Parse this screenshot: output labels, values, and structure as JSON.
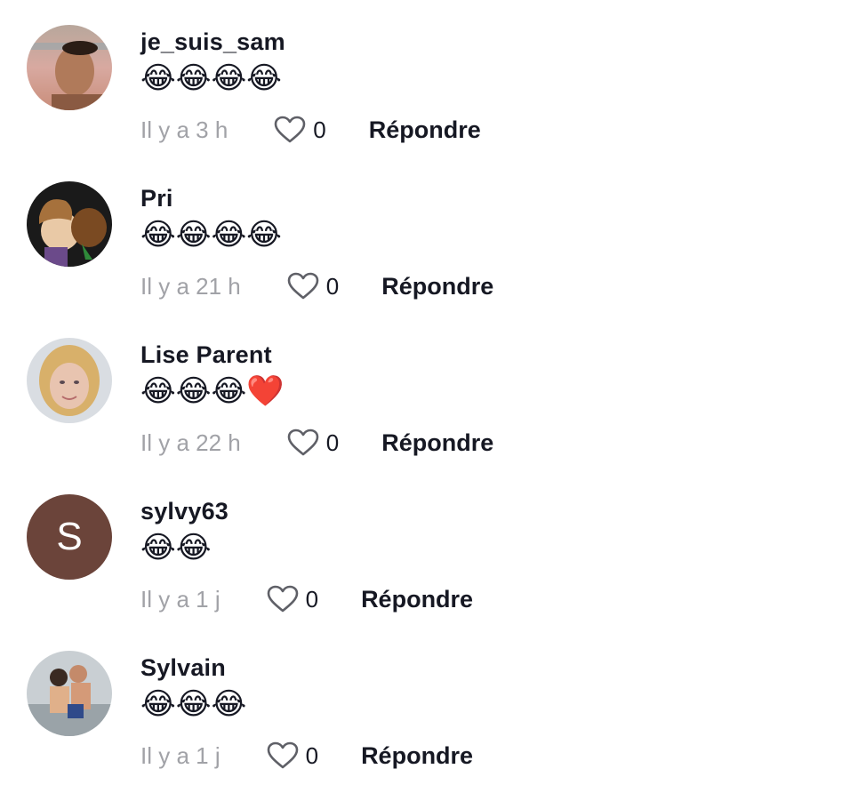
{
  "comments": [
    {
      "username": "je_suis_sam",
      "text": "😂😂😂😂",
      "time": "Il y a 3 h",
      "likes": "0",
      "reply_label": "Répondre",
      "avatar": "photo"
    },
    {
      "username": "Pri",
      "text": "😂😂😂😂",
      "time": "Il y a 21 h",
      "likes": "0",
      "reply_label": "Répondre",
      "avatar": "photo"
    },
    {
      "username": "Lise Parent",
      "text": "😂😂😂❤️",
      "time": "Il y a 22 h",
      "likes": "0",
      "reply_label": "Répondre",
      "avatar": "photo"
    },
    {
      "username": "sylvy63",
      "text": "😂😂",
      "time": "Il y a 1 j",
      "likes": "0",
      "reply_label": "Répondre",
      "avatar": "S"
    },
    {
      "username": "Sylvain",
      "text": "😂😂😂",
      "time": "Il y a 1 j",
      "likes": "0",
      "reply_label": "Répondre",
      "avatar": "photo"
    }
  ],
  "colors": {
    "text": "#161823",
    "muted": "#a1a2a7",
    "letter_avatar_bg": "#6b443a"
  },
  "icons": {
    "like": "heart-outline-icon"
  }
}
